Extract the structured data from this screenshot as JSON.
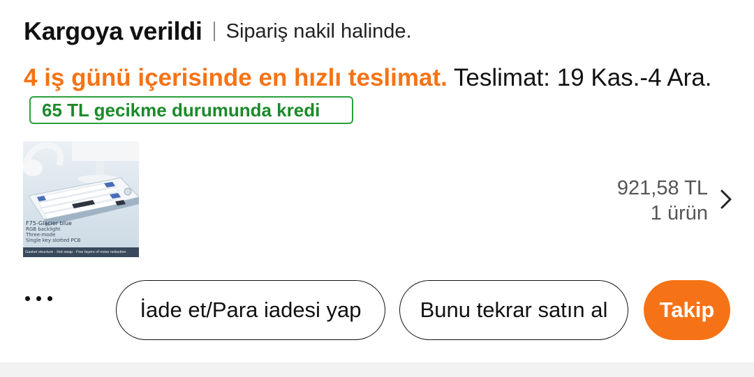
{
  "order": {
    "status_title": "Kargoya verildi",
    "status_subtitle": "Sipariş nakil halinde."
  },
  "delivery": {
    "fast_text": "4 iş günü içerisinde en hızlı teslimat.",
    "date_text": " Teslimat: 19 Kas.-4 Ara.",
    "credit_badge": "65 TL gecikme durumunda kredi"
  },
  "product": {
    "thumb_model": "F75",
    "thumb_variant": "-Glacier blue",
    "thumb_features": [
      "RGB backlight",
      "Three-mode",
      "Single key slotted PCB"
    ],
    "thumb_footer": "Gasket structure · Hot swap · Five layers of noise reduction",
    "price": "921,58 TL",
    "quantity": "1 ürün"
  },
  "actions": {
    "refund_label": "İade et/Para iadesi yap",
    "rebuy_label": "Bunu tekrar satın al",
    "track_label": "Takip"
  },
  "colors": {
    "accent": "#f57316",
    "credit_green": "#1b8a2a"
  }
}
